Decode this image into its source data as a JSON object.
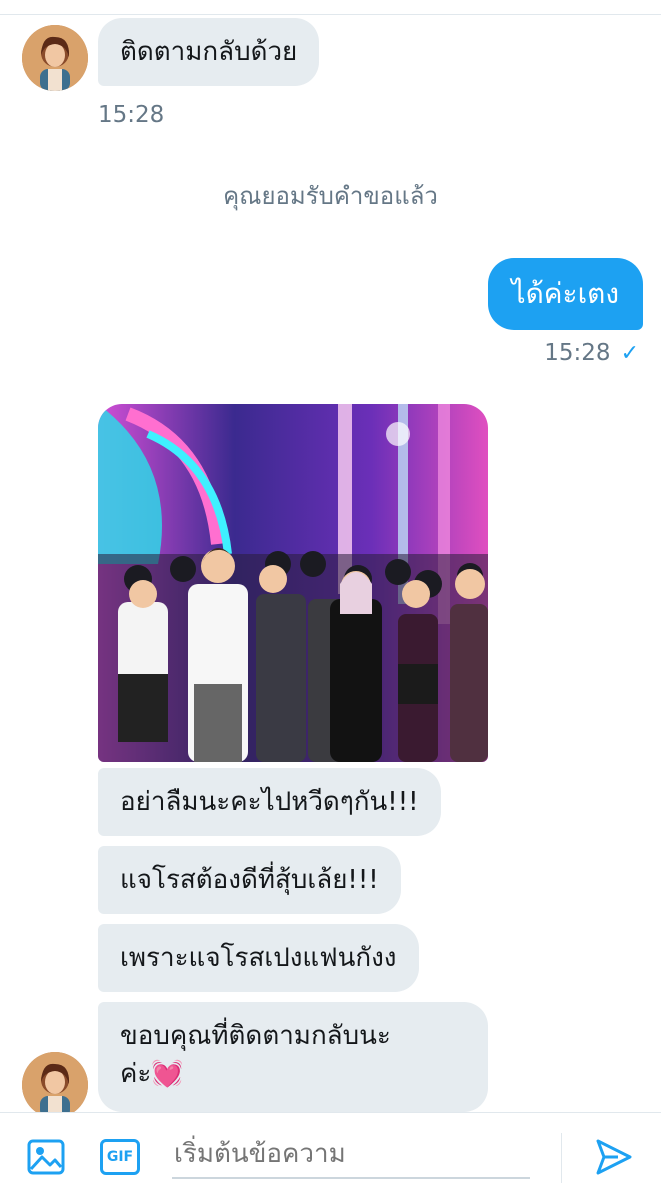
{
  "conversation": {
    "first_message": {
      "text": "ติดตามกลับด้วย",
      "time": "15:28"
    },
    "system_note": "คุณยอมรับคำขอแล้ว",
    "sent_message": {
      "text": "ได้ค่ะเตง",
      "time": "15:28",
      "status_icon": "checkmark-icon"
    },
    "media_message": {
      "kind": "photo",
      "description_icon": "stage-photo"
    },
    "incoming_messages": [
      {
        "text": "อย่าลืมนะคะไปหวีดๆกัน!!!"
      },
      {
        "text": "แจโรสต้องดีที่สุ้บเล้ย!!!"
      },
      {
        "text": "เพราะแจโรสเปงแฟนกังง"
      },
      {
        "line1": "ขอบคุณที่ติดตามกลับนะ",
        "line2": "ค่ะ",
        "emoji": "💓"
      }
    ]
  },
  "composer": {
    "placeholder": "เริ่มต้นข้อความ",
    "gif_label": "GIF",
    "image_icon": "image-icon",
    "send_icon": "send-icon"
  },
  "colors": {
    "accent": "#1da1f2",
    "incoming_bubble": "#e6ecf0",
    "muted_text": "#657786"
  }
}
